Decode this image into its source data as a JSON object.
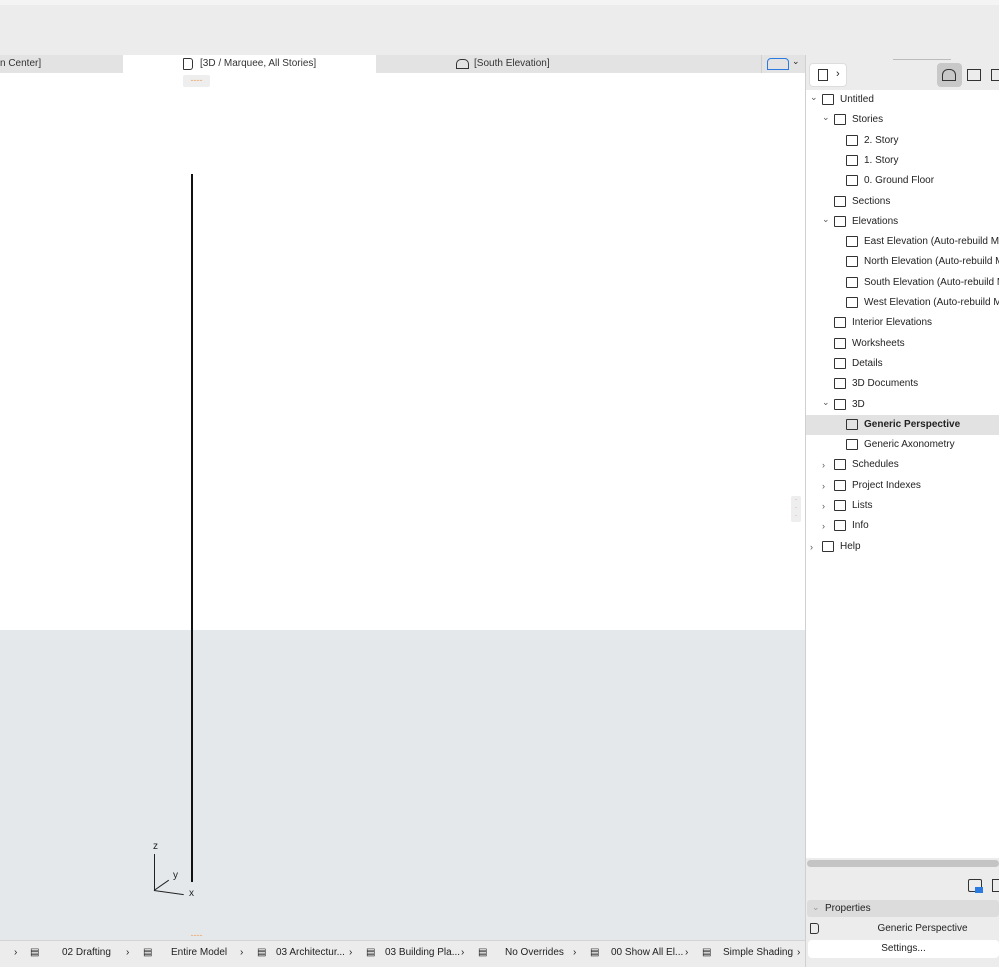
{
  "tabs": [
    {
      "label": "n Center]"
    },
    {
      "label": "[3D / Marquee, All Stories]",
      "active": true
    },
    {
      "label": "[South Elevation]"
    }
  ],
  "axes": {
    "z": "z",
    "y": "y",
    "x": "x"
  },
  "status_bar": [
    {
      "label": "02 Drafting",
      "icon": "layers-icon"
    },
    {
      "label": "Entire Model",
      "icon": "model-icon"
    },
    {
      "label": "03 Architectur...",
      "icon": "pen-icon"
    },
    {
      "label": "03 Building Pla...",
      "icon": "plan-icon"
    },
    {
      "label": "No Overrides",
      "icon": "override-icon"
    },
    {
      "label": "00 Show All El...",
      "icon": "filter-icon"
    },
    {
      "label": "Simple Shading",
      "icon": "cube-icon"
    }
  ],
  "navigator": {
    "items": [
      {
        "label": "Untitled",
        "level": 0,
        "expanded": true,
        "icon": "project-icon"
      },
      {
        "label": "Stories",
        "level": 1,
        "expanded": true,
        "icon": "story-icon"
      },
      {
        "label": "2. Story",
        "level": 2,
        "icon": "story-icon"
      },
      {
        "label": "1. Story",
        "level": 2,
        "icon": "story-icon"
      },
      {
        "label": "0. Ground Floor",
        "level": 2,
        "icon": "story-icon"
      },
      {
        "label": "Sections",
        "level": 1,
        "icon": "section-icon"
      },
      {
        "label": "Elevations",
        "level": 1,
        "expanded": true,
        "icon": "elevation-icon"
      },
      {
        "label": "East Elevation (Auto-rebuild M",
        "level": 2,
        "icon": "elevation-icon"
      },
      {
        "label": "North Elevation (Auto-rebuild M",
        "level": 2,
        "icon": "elevation-icon"
      },
      {
        "label": "South Elevation (Auto-rebuild M",
        "level": 2,
        "icon": "elevation-icon"
      },
      {
        "label": "West Elevation (Auto-rebuild M",
        "level": 2,
        "icon": "elevation-icon"
      },
      {
        "label": "Interior Elevations",
        "level": 1,
        "icon": "interior-elevation-icon"
      },
      {
        "label": "Worksheets",
        "level": 1,
        "icon": "worksheet-icon"
      },
      {
        "label": "Details",
        "level": 1,
        "icon": "detail-icon"
      },
      {
        "label": "3D Documents",
        "level": 1,
        "icon": "3d-document-icon"
      },
      {
        "label": "3D",
        "level": 1,
        "expanded": true,
        "icon": "3d-icon"
      },
      {
        "label": "Generic Perspective",
        "level": 2,
        "selected": true,
        "icon": "perspective-icon"
      },
      {
        "label": "Generic Axonometry",
        "level": 2,
        "icon": "axonometry-icon"
      },
      {
        "label": "Schedules",
        "level": 1,
        "collapsed": true,
        "icon": "schedule-icon"
      },
      {
        "label": "Project Indexes",
        "level": 1,
        "collapsed": true,
        "icon": "index-icon"
      },
      {
        "label": "Lists",
        "level": 1,
        "collapsed": true,
        "icon": "list-icon"
      },
      {
        "label": "Info",
        "level": 1,
        "collapsed": true,
        "icon": "info-icon"
      },
      {
        "label": "Help",
        "level": 0,
        "collapsed": true,
        "icon": "help-icon"
      }
    ]
  },
  "properties": {
    "header": "Properties",
    "view_name": "Generic Perspective",
    "settings_label": "Settings..."
  },
  "colors": {
    "accent": "#f0a060",
    "selection": "#e2e2e2",
    "ground": "#e4e8eb",
    "blue_icon": "#2a7ae2"
  }
}
